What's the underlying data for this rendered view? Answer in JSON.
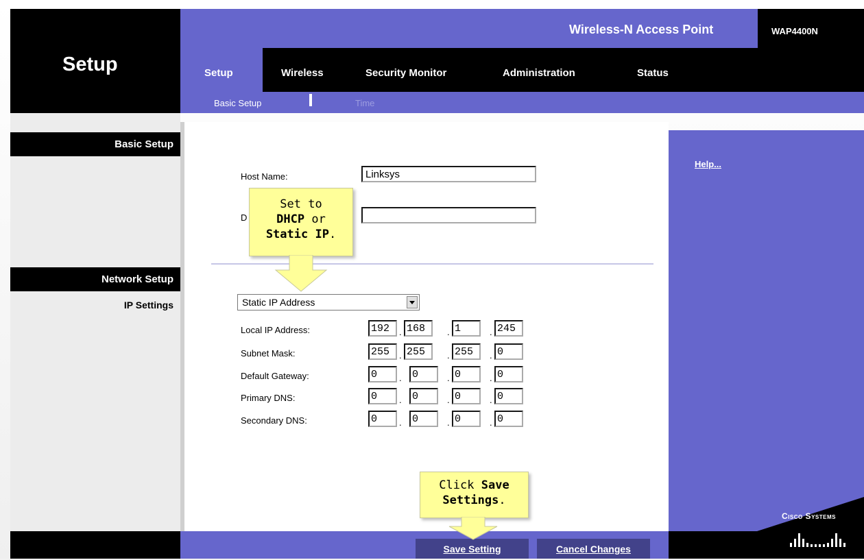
{
  "header": {
    "section_title": "Setup",
    "product_name": "Wireless-N Access Point",
    "model": "WAP4400N"
  },
  "tabs": [
    {
      "label": "Setup",
      "active": true
    },
    {
      "label": "Wireless"
    },
    {
      "label": "Security Monitor"
    },
    {
      "label": "Administration"
    },
    {
      "label": "Status"
    }
  ],
  "subtabs": [
    {
      "label": "Basic Setup",
      "active": true
    },
    {
      "label": "Time"
    }
  ],
  "sidebar": {
    "basic_setup": "Basic Setup",
    "network_setup": "Network Setup",
    "ip_settings": "IP Settings"
  },
  "form": {
    "host_name_label": "Host Name:",
    "host_name_value": "Linksys",
    "domain_label_visible": "D",
    "domain_value": "",
    "ip_mode_selected": "Static IP Address",
    "rows": [
      {
        "label": "Local IP Address:",
        "octets": [
          "192",
          "168",
          "1",
          "245"
        ]
      },
      {
        "label": "Subnet Mask:",
        "octets": [
          "255",
          "255",
          "255",
          "0"
        ]
      },
      {
        "label": "Default Gateway:",
        "octets": [
          "0",
          "0",
          "0",
          "0"
        ]
      },
      {
        "label": "Primary DNS:",
        "octets": [
          "0",
          "0",
          "0",
          "0"
        ]
      },
      {
        "label": "Secondary DNS:",
        "octets": [
          "0",
          "0",
          "0",
          "0"
        ]
      }
    ],
    "octet_separator": "."
  },
  "help": {
    "link": "Help..."
  },
  "footer": {
    "save": "Save Setting",
    "cancel": "Cancel Changes"
  },
  "brand": {
    "logo_text": "Cisco Systems"
  },
  "callouts": {
    "c1_line1": "Set to",
    "c1_bold1": "DHCP",
    "c1_or": "or",
    "c1_bold2": "Static IP",
    "c1_period": ".",
    "c2_click": "Click",
    "c2_bold1": "Save",
    "c2_bold2": "Settings",
    "c2_period": "."
  },
  "colors": {
    "purple": "#6666cc",
    "black": "#000000",
    "callout_yellow": "#ffff99"
  }
}
